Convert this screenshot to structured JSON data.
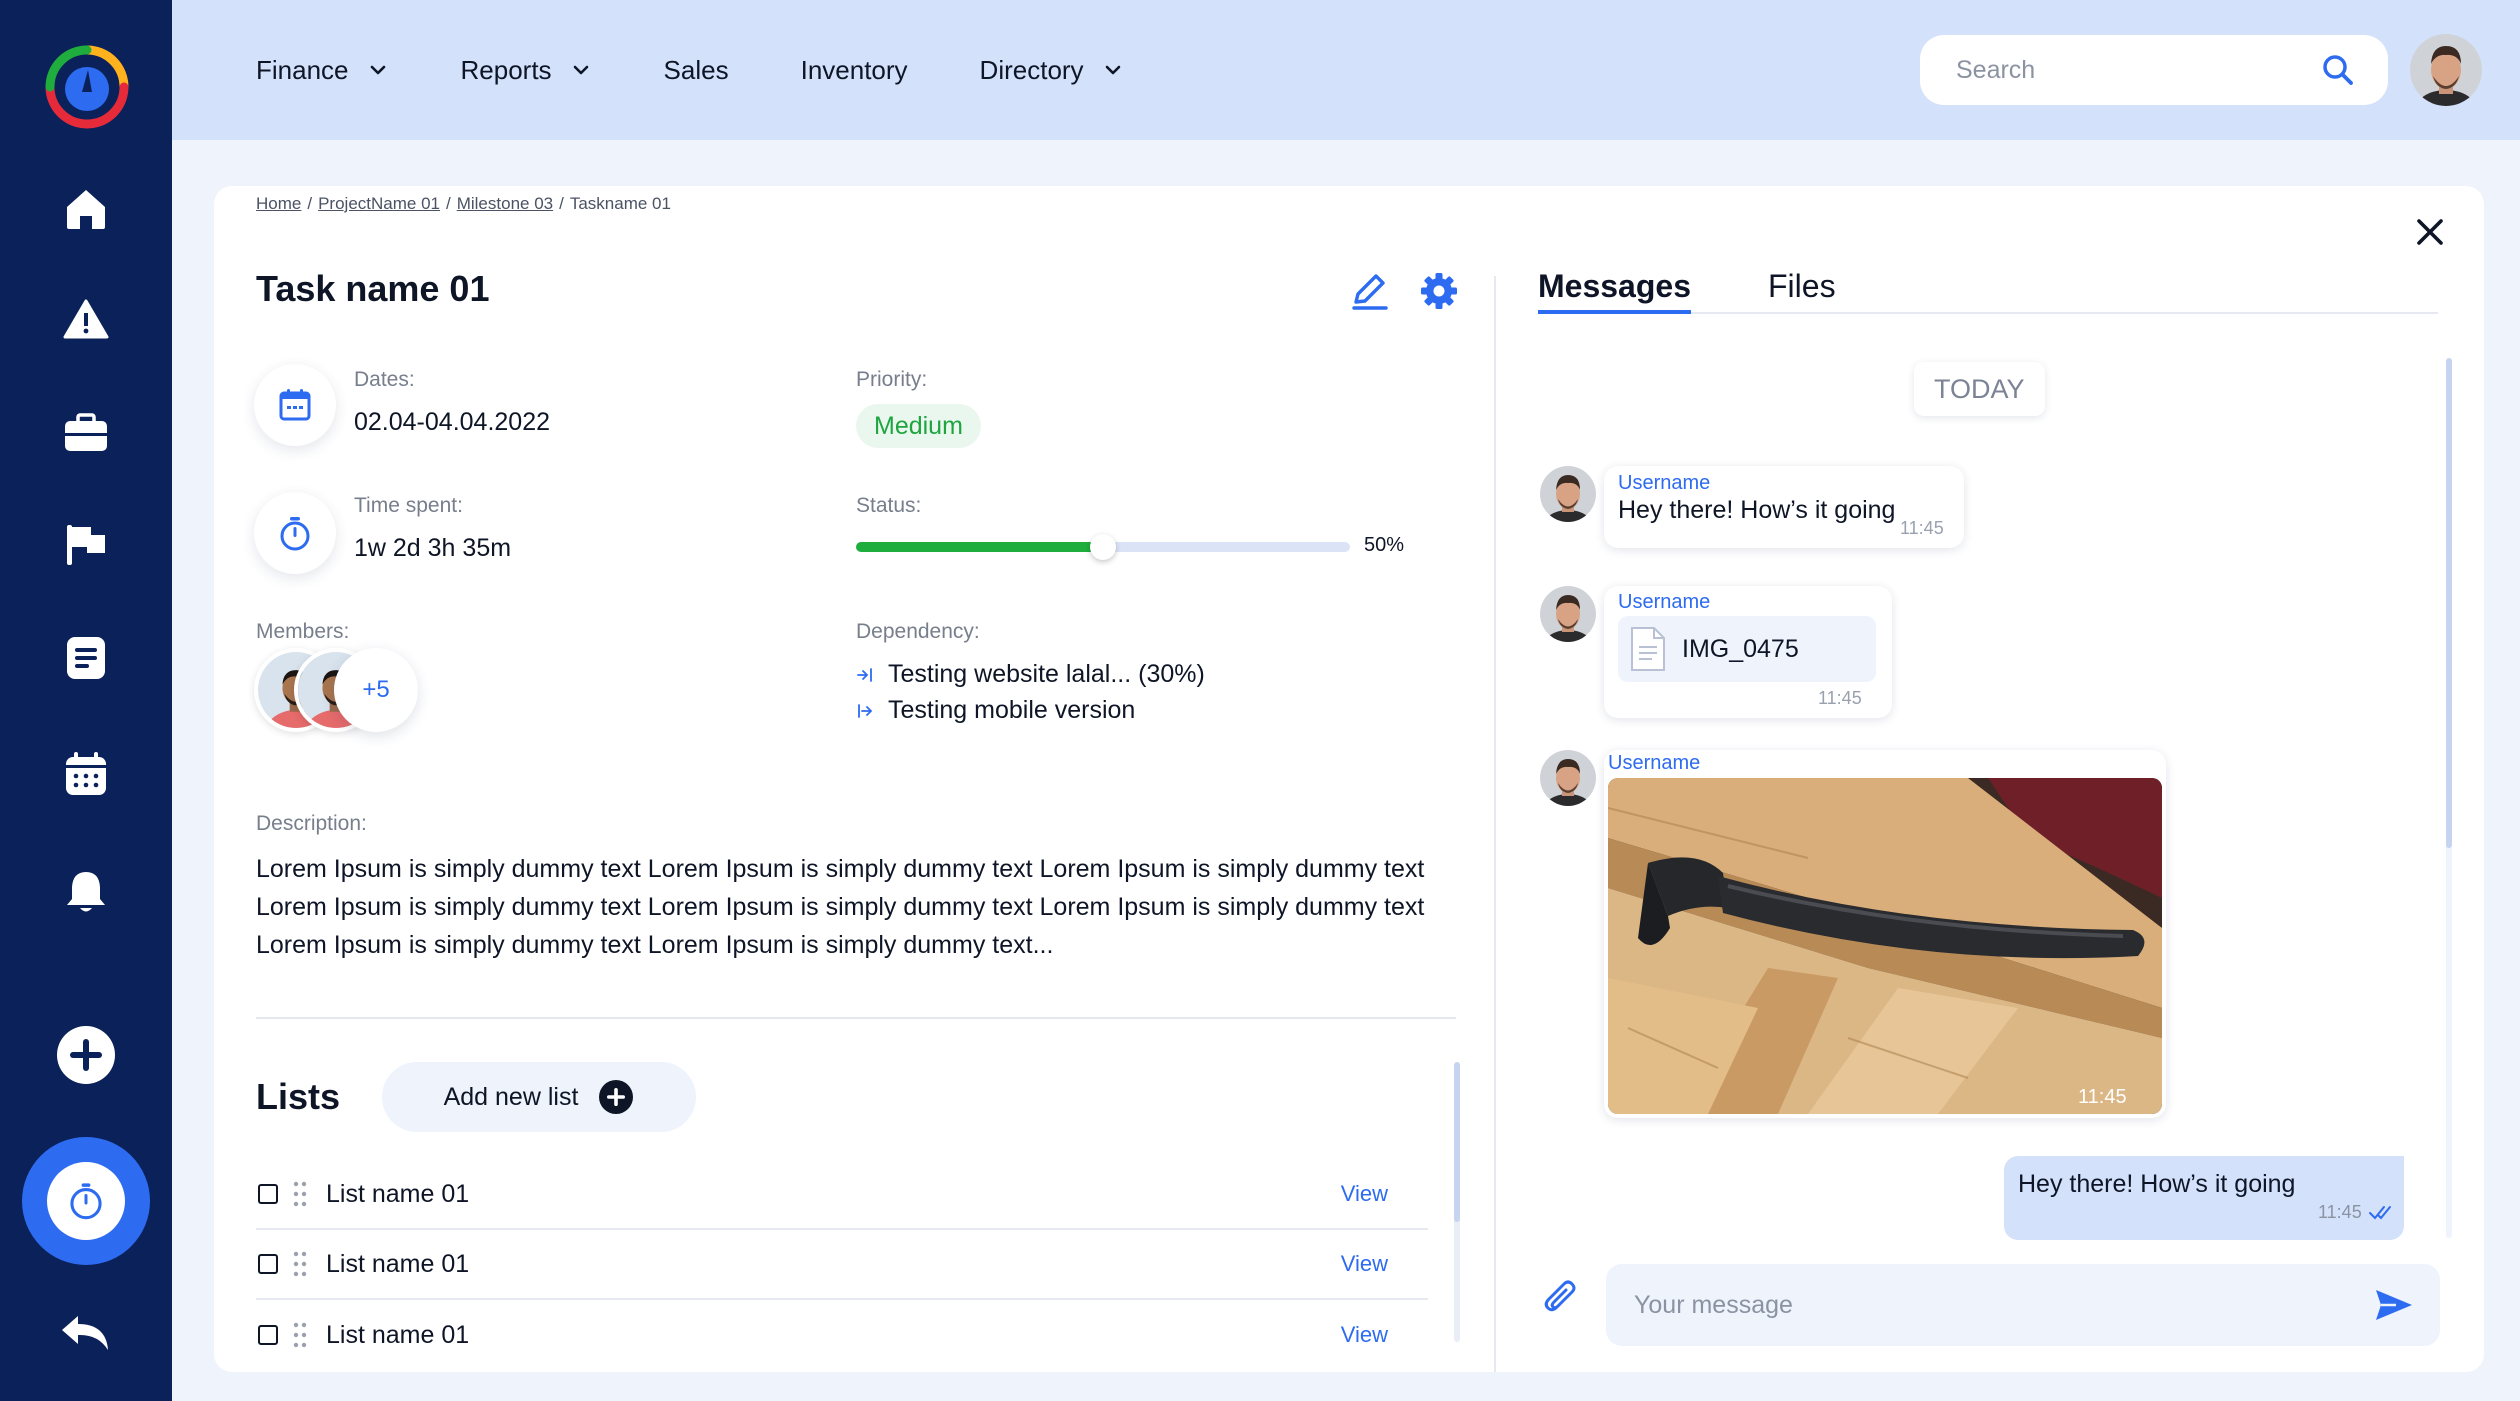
{
  "nav": {
    "items": [
      {
        "label": "Finance",
        "dropdown": true
      },
      {
        "label": "Reports",
        "dropdown": true
      },
      {
        "label": "Sales",
        "dropdown": false
      },
      {
        "label": "Inventory",
        "dropdown": false
      },
      {
        "label": "Directory",
        "dropdown": true
      }
    ],
    "search_placeholder": "Search"
  },
  "sidebar": {
    "icons": [
      "home-icon",
      "warning-icon",
      "briefcase-icon",
      "flag-icon",
      "document-icon",
      "calendar-icon",
      "bell-icon",
      "add-icon",
      "timer-icon",
      "back-icon"
    ]
  },
  "breadcrumb": {
    "items": [
      "Home",
      "ProjectName 01",
      "Milestone 03"
    ],
    "current": "Taskname 01",
    "separator": "/"
  },
  "task": {
    "title": "Task name 01",
    "dates_label": "Dates:",
    "dates_value": "02.04-04.04.2022",
    "time_label": "Time spent:",
    "time_value": "1w 2d 3h 35m",
    "priority_label": "Priority:",
    "priority_value": "Medium",
    "status_label": "Status:",
    "status_percent": 50,
    "status_text": "50%",
    "members_label": "Members:",
    "members_more": "+5",
    "dependency_label": "Dependency:",
    "dependencies": [
      "Testing website lalal... (30%)",
      "Testing mobile version"
    ],
    "description_label": "Description:",
    "description": "Lorem Ipsum is simply dummy text Lorem Ipsum is simply dummy text Lorem Ipsum is simply dummy text Lorem Ipsum is simply dummy text Lorem Ipsum is simply dummy text Lorem Ipsum is simply dummy text Lorem Ipsum is simply dummy text Lorem Ipsum is simply dummy text..."
  },
  "lists": {
    "title": "Lists",
    "add_label": "Add new list",
    "items": [
      {
        "name": "List name 01",
        "action": "View"
      },
      {
        "name": "List name 01",
        "action": "View"
      },
      {
        "name": "List name 01",
        "action": "View"
      }
    ]
  },
  "messages": {
    "tabs": [
      "Messages",
      "Files"
    ],
    "active_tab": "Messages",
    "day_label": "TODAY",
    "items": [
      {
        "username": "Username",
        "text": "Hey there! How’s it going",
        "time": "11:45"
      },
      {
        "username": "Username",
        "file": "IMG_0475",
        "time": "11:45"
      },
      {
        "username": "Username",
        "time": "11:45"
      }
    ],
    "outgoing": {
      "text": "Hey there! How’s it going",
      "time": "11:45"
    },
    "input_placeholder": "Your message"
  },
  "colors": {
    "sidebar": "#0b2159",
    "topbar": "#d3e1fa",
    "accent": "#2d6bf0",
    "success": "#1fae3d"
  }
}
